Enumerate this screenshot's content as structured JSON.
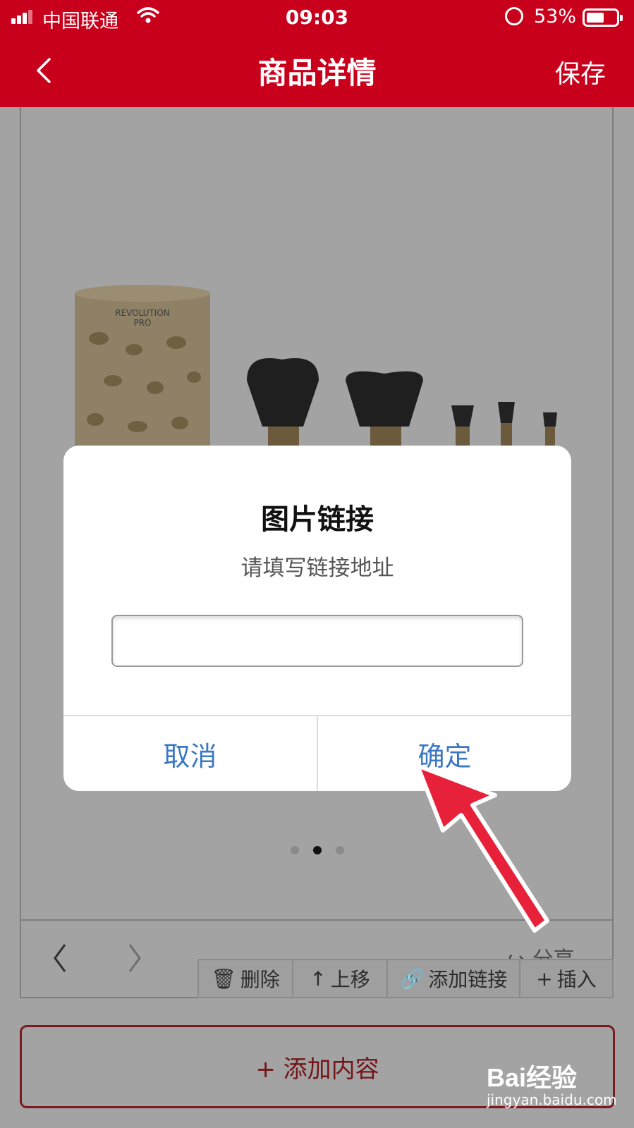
{
  "status_bar": {
    "carrier": "中国联通",
    "time": "09:03",
    "battery_percent": "53%",
    "battery_level": 0.53
  },
  "nav": {
    "title": "商品详情",
    "save_label": "保存"
  },
  "product_image": {
    "brand_text_line1": "REVOLUTION",
    "brand_text_line2": "PRO"
  },
  "carousel": {
    "page_count": 3,
    "active_index": 1
  },
  "toolbar": {
    "share_label": "分享",
    "delete_label": "删除",
    "move_up_label": "上移",
    "add_link_label": "添加链接",
    "insert_label": "插入"
  },
  "add_content_label": "+ 添加内容",
  "dialog": {
    "title": "图片链接",
    "message": "请填写链接地址",
    "input_value": "",
    "cancel_label": "取消",
    "confirm_label": "确定"
  },
  "watermark": {
    "logo": "Bai经验",
    "url": "jingyan.baidu.com"
  },
  "colors": {
    "nav_red": "#c8001c",
    "dialog_button_blue": "#3b78c2",
    "annotation_arrow": "#e8213a"
  }
}
